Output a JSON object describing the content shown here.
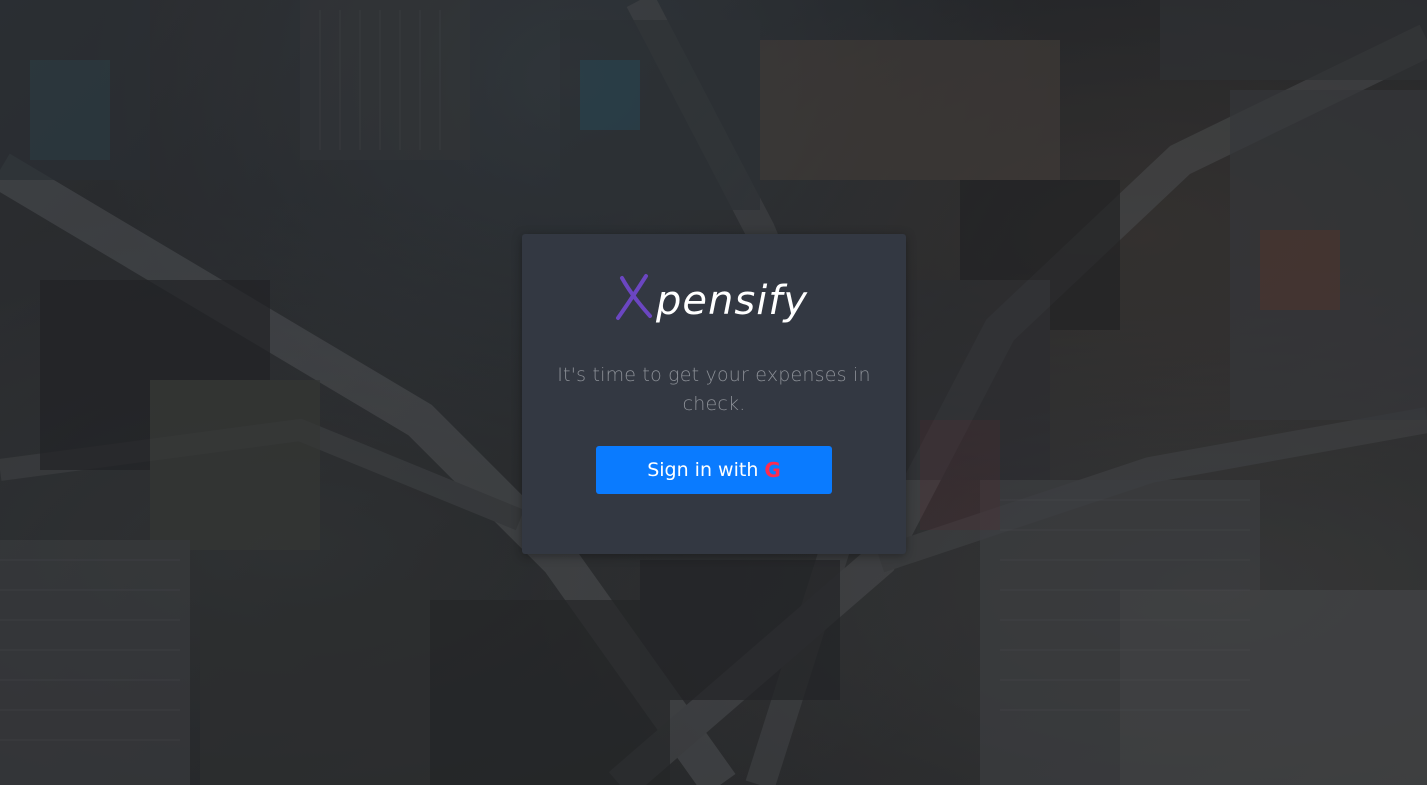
{
  "brand": {
    "logo_first": "X",
    "logo_rest": "pensify",
    "logo_first_color": "#6b46c1",
    "logo_rest_color": "#ffffff"
  },
  "login": {
    "tagline": "It's time to get your expenses in check.",
    "signin_label": "Sign in with",
    "signin_icon": "google-icon",
    "signin_icon_glyph": "G",
    "button_color": "#0a7bff",
    "icon_color": "#ff2a4f"
  },
  "theme": {
    "card_background": "#333842",
    "tagline_color": "#8b8f96"
  }
}
